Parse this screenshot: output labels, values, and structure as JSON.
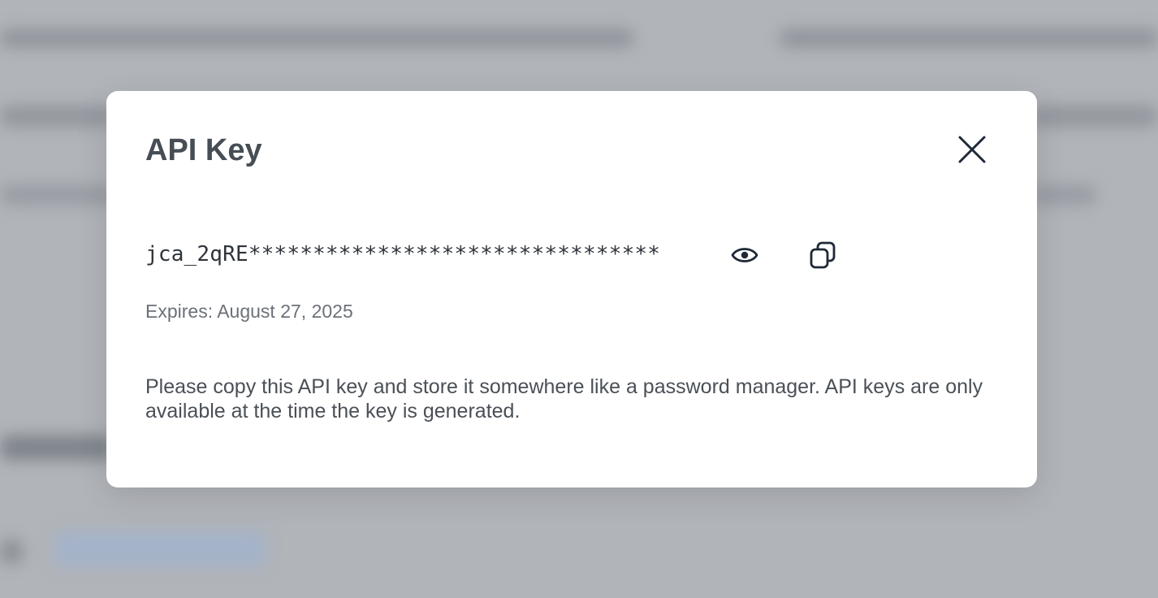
{
  "dialog": {
    "title": "API Key",
    "close_icon": "close-icon",
    "api_key_masked": "jca_2qRE********************************",
    "reveal_icon": "eye-icon",
    "copy_icon": "copy-icon",
    "expires_text": "Expires: August 27, 2025",
    "notice_text": "Please copy this API key and store it somewhere like a password manager. API keys are only available at the time the key is generated."
  },
  "colors": {
    "overlay": "#b1b4b9",
    "dialog_background": "#ffffff",
    "title": "#464d55",
    "icon": "#1f2937"
  }
}
